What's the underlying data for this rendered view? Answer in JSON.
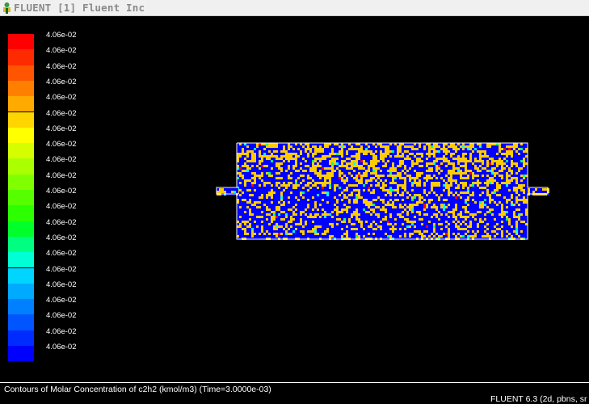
{
  "window": {
    "title": "FLUENT [1] Fluent Inc",
    "icon": "fluent-app-icon"
  },
  "legend": {
    "labels": [
      "4.06e-02",
      "4.06e-02",
      "4.06e-02",
      "4.06e-02",
      "4.06e-02",
      "4.06e-02",
      "4.06e-02",
      "4.06e-02",
      "4.06e-02",
      "4.06e-02",
      "4.06e-02",
      "4.06e-02",
      "4.06e-02",
      "4.06e-02",
      "4.06e-02",
      "4.06e-02",
      "4.06e-02",
      "4.06e-02",
      "4.06e-02",
      "4.06e-02",
      "4.06e-02"
    ],
    "colors": [
      "#ff0000",
      "#ff2b00",
      "#ff5500",
      "#ff8000",
      "#ffaa00",
      "#ffd500",
      "#ffff00",
      "#d5ff00",
      "#aaff00",
      "#80ff00",
      "#55ff00",
      "#2bff00",
      "#00ff2b",
      "#00ff80",
      "#00ffd5",
      "#00d5ff",
      "#00aaff",
      "#0080ff",
      "#0055ff",
      "#002bff",
      "#0000ff"
    ]
  },
  "plot": {
    "domain_colors": [
      "#0000ff",
      "#ffcc00",
      "#00ffff",
      "#00ff80",
      "#ff0000"
    ]
  },
  "caption": {
    "text": "Contours of Molar Concentration of c2h2 (kmol/m3)  (Time=3.0000e-03)"
  },
  "version": {
    "text": "FLUENT 6.3 (2d, pbns, sr"
  }
}
